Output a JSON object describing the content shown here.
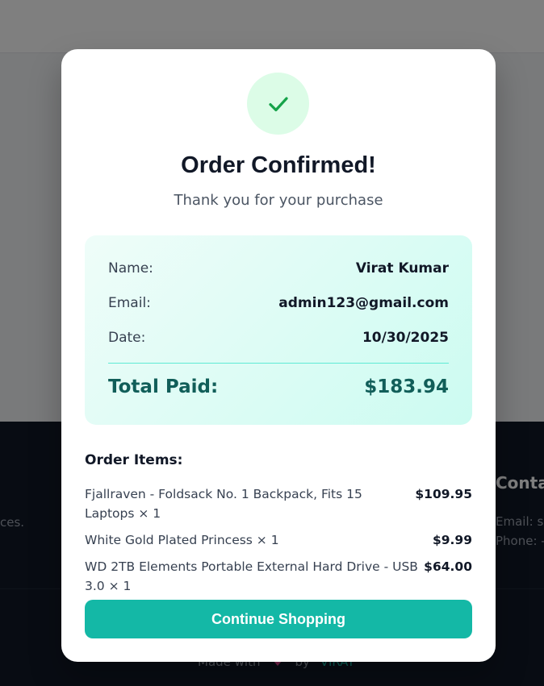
{
  "background": {
    "footer_fragment_left": "ces.",
    "contact_heading": "Conta",
    "contact_email": "Email: su",
    "contact_phone": "Phone: -",
    "made_with": "Made with",
    "by": "by",
    "author": "VIRAT"
  },
  "modal": {
    "icon": "check-icon",
    "title": "Order Confirmed!",
    "subtitle": "Thank you for your purchase",
    "summary": {
      "name_label": "Name:",
      "name_value": "Virat Kumar",
      "email_label": "Email:",
      "email_value": "admin123@gmail.com",
      "date_label": "Date:",
      "date_value": "10/30/2025",
      "total_label": "Total Paid:",
      "total_value": "$183.94"
    },
    "items_heading": "Order Items:",
    "items": [
      {
        "name": "Fjallraven - Foldsack No. 1 Backpack, Fits 15 Laptops × 1",
        "price": "$109.95"
      },
      {
        "name": "White Gold Plated Princess × 1",
        "price": "$9.99"
      },
      {
        "name": "WD 2TB Elements Portable External Hard Drive - USB 3.0 × 1",
        "price": "$64.00"
      }
    ],
    "cta_label": "Continue Shopping"
  },
  "colors": {
    "accent": "#14b8a6",
    "success": "#16a34a",
    "total_text": "#115e59"
  }
}
